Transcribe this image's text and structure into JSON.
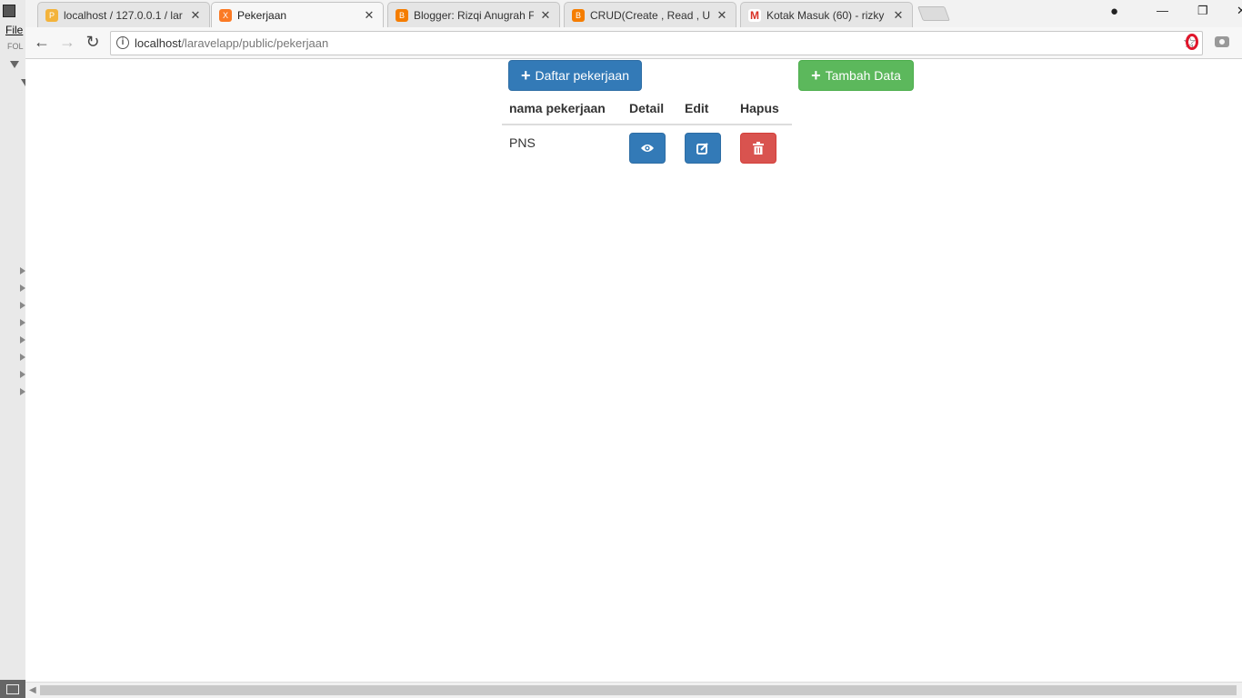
{
  "browser": {
    "tabs": [
      {
        "label": "localhost / 127.0.0.1 / lar",
        "favicon": "phpmyadmin-icon"
      },
      {
        "label": "Pekerjaan",
        "favicon": "xampp-icon",
        "active": true
      },
      {
        "label": "Blogger: Rizqi Anugrah F",
        "favicon": "blogger-icon"
      },
      {
        "label": "CRUD(Create , Read , Up",
        "favicon": "blogger-icon"
      },
      {
        "label": "Kotak Masuk (60) - rizky",
        "favicon": "gmail-icon"
      }
    ],
    "url_host": "localhost",
    "url_path": "/laravelapp/public/pekerjaan"
  },
  "background_app": {
    "menu_file": "File",
    "folders_label": "FOL"
  },
  "page": {
    "daftar_button": "Daftar pekerjaan",
    "tambah_button": "Tambah Data",
    "table": {
      "headers": [
        "nama pekerjaan",
        "Detail",
        "Edit",
        "Hapus"
      ],
      "rows": [
        {
          "nama": "PNS"
        }
      ]
    }
  },
  "colors": {
    "primary": "#337ab7",
    "success": "#5cb85c",
    "danger": "#d9534f"
  }
}
